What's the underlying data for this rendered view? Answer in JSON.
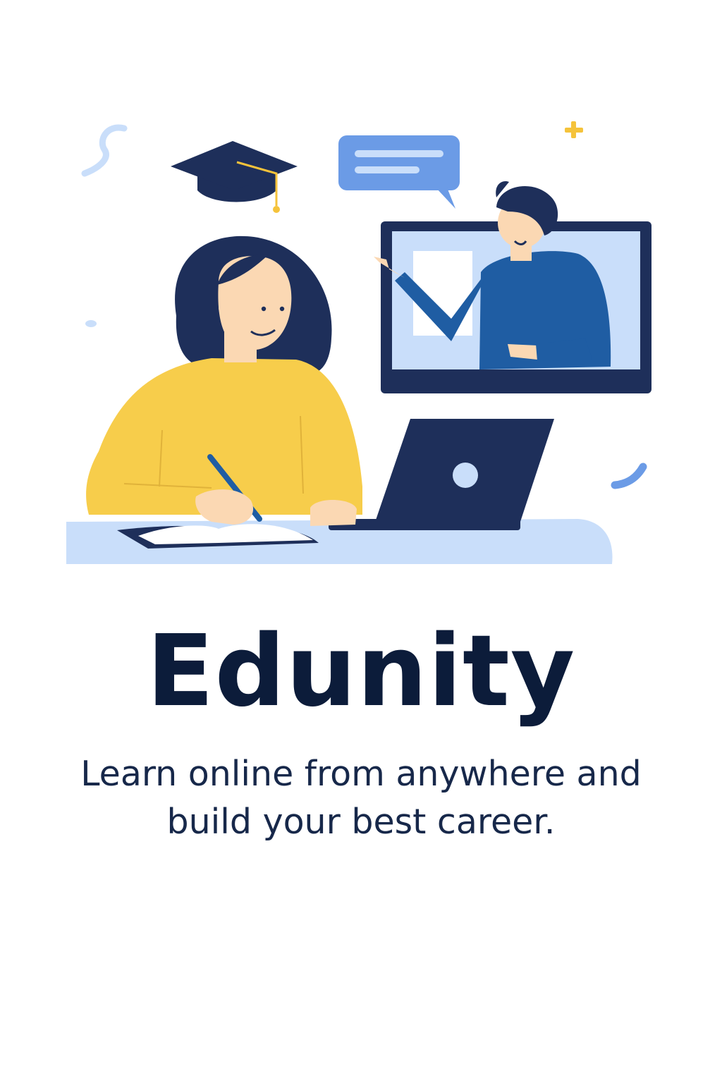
{
  "app": {
    "title": "Edunity",
    "tagline_line1": "Learn online from anywhere and",
    "tagline_line2": "build your best career."
  },
  "illustration": {
    "subject": "online learning scene",
    "icons": [
      "graduation-cap-icon",
      "chat-bubble-icon",
      "plus-sparkle-icon",
      "laptop-icon",
      "monitor-icon",
      "notebook-icon",
      "pen-icon"
    ]
  },
  "colors": {
    "background": "#ffffff",
    "title": "#0c1c3a",
    "text": "#17284a",
    "navy": "#1e2f5a",
    "accent_blue": "#6b9be6",
    "light_blue": "#c9defa",
    "sweater_yellow": "#f7cd4b",
    "teacher_blue": "#1f5da3",
    "skin": "#fbd8b3",
    "sparkle_yellow": "#f5c33b"
  }
}
